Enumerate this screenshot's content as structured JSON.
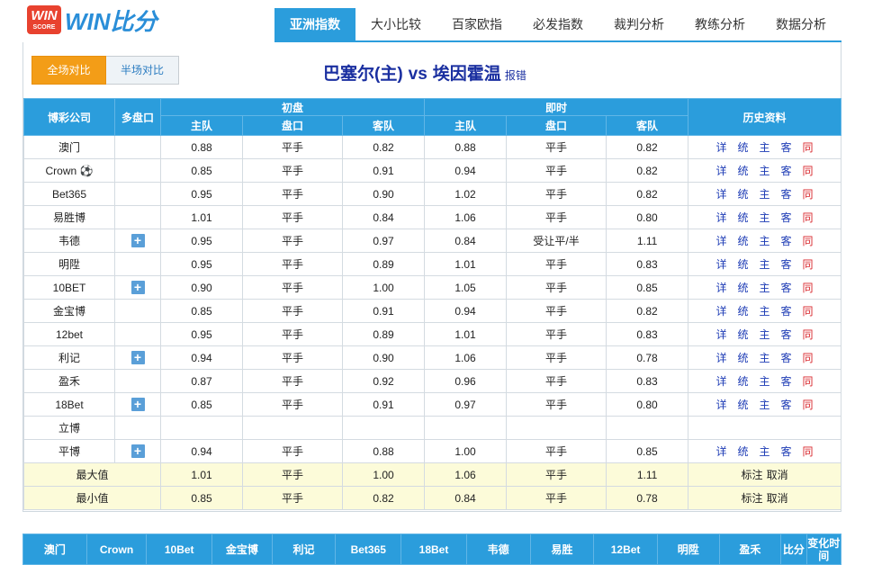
{
  "logo": {
    "box_top": "WIN",
    "box_bottom": "SCORE",
    "text": "WIN比分"
  },
  "nav": [
    {
      "label": "亚洲指数",
      "active": true
    },
    {
      "label": "大小比较"
    },
    {
      "label": "百家欧指"
    },
    {
      "label": "必发指数"
    },
    {
      "label": "裁判分析"
    },
    {
      "label": "教练分析"
    },
    {
      "label": "数据分析"
    }
  ],
  "toggle": {
    "full": "全场对比",
    "half": "半场对比"
  },
  "match": {
    "home": "巴塞尔(主)",
    "vs": "vs",
    "away": "埃因霍温",
    "report": "报错"
  },
  "headers": {
    "company": "博彩公司",
    "multi": "多盘口",
    "initial": "初盘",
    "live": "即时",
    "history": "历史资料",
    "home": "主队",
    "line": "盘口",
    "away": "客队"
  },
  "history_links": [
    "详",
    "统",
    "主",
    "客",
    "同"
  ],
  "rows": [
    {
      "company": "澳门",
      "multi": false,
      "i_home": "0.88",
      "i_line": "平手",
      "i_away": "0.82",
      "l_home": "0.88",
      "l_line": "平手",
      "l_away": "0.82",
      "hist": true
    },
    {
      "company": "Crown ⚽",
      "multi": false,
      "i_home": "0.85",
      "i_line": "平手",
      "i_away": "0.91",
      "l_home": "0.94",
      "l_line": "平手",
      "l_away": "0.82",
      "hist": true
    },
    {
      "company": "Bet365",
      "multi": false,
      "i_home": "0.95",
      "i_line": "平手",
      "i_away": "0.90",
      "l_home": "1.02",
      "l_line": "平手",
      "l_away": "0.82",
      "hist": true
    },
    {
      "company": "易胜博",
      "multi": false,
      "i_home": "1.01",
      "i_line": "平手",
      "i_away": "0.84",
      "l_home": "1.06",
      "l_line": "平手",
      "l_away": "0.80",
      "hist": true
    },
    {
      "company": "韦德",
      "multi": true,
      "i_home": "0.95",
      "i_line": "平手",
      "i_away": "0.97",
      "l_home": "0.84",
      "l_line": "受让平/半",
      "l_away": "1.11",
      "hist": true
    },
    {
      "company": "明陞",
      "multi": false,
      "i_home": "0.95",
      "i_line": "平手",
      "i_away": "0.89",
      "l_home": "1.01",
      "l_line": "平手",
      "l_away": "0.83",
      "hist": true
    },
    {
      "company": "10BET",
      "multi": true,
      "i_home": "0.90",
      "i_line": "平手",
      "i_away": "1.00",
      "l_home": "1.05",
      "l_line": "平手",
      "l_away": "0.85",
      "hist": true
    },
    {
      "company": "金宝博",
      "multi": false,
      "i_home": "0.85",
      "i_line": "平手",
      "i_away": "0.91",
      "l_home": "0.94",
      "l_line": "平手",
      "l_away": "0.82",
      "hist": true
    },
    {
      "company": "12bet",
      "multi": false,
      "i_home": "0.95",
      "i_line": "平手",
      "i_away": "0.89",
      "l_home": "1.01",
      "l_line": "平手",
      "l_away": "0.83",
      "hist": true
    },
    {
      "company": "利记",
      "multi": true,
      "i_home": "0.94",
      "i_line": "平手",
      "i_away": "0.90",
      "l_home": "1.06",
      "l_line": "平手",
      "l_away": "0.78",
      "hist": true
    },
    {
      "company": "盈禾",
      "multi": false,
      "i_home": "0.87",
      "i_line": "平手",
      "i_away": "0.92",
      "l_home": "0.96",
      "l_line": "平手",
      "l_away": "0.83",
      "hist": true
    },
    {
      "company": "18Bet",
      "multi": true,
      "i_home": "0.85",
      "i_line": "平手",
      "i_away": "0.91",
      "l_home": "0.97",
      "l_line": "平手",
      "l_away": "0.80",
      "hist": true
    },
    {
      "company": "立博",
      "multi": false,
      "i_home": "",
      "i_line": "",
      "i_away": "",
      "l_home": "",
      "l_line": "",
      "l_away": "",
      "hist": false
    },
    {
      "company": "平博",
      "multi": true,
      "i_home": "0.94",
      "i_line": "平手",
      "i_away": "0.88",
      "l_home": "1.00",
      "l_line": "平手",
      "l_away": "0.85",
      "hist": true
    }
  ],
  "stats": [
    {
      "label": "最大值",
      "i_home": "1.01",
      "i_line": "平手",
      "i_away": "1.00",
      "l_home": "1.06",
      "l_line": "平手",
      "l_away": "1.11"
    },
    {
      "label": "最小值",
      "i_home": "0.85",
      "i_line": "平手",
      "i_away": "0.82",
      "l_home": "0.84",
      "l_line": "平手",
      "l_away": "0.78"
    }
  ],
  "stat_actions": {
    "mark": "标注",
    "cancel": "取消"
  },
  "bottom_bar": [
    "澳门",
    "Crown",
    "10Bet",
    "金宝博",
    "利记",
    "Bet365",
    "18Bet",
    "韦德",
    "易胜",
    "12Bet",
    "明陞",
    "盈禾",
    "比分",
    "变化时间"
  ]
}
